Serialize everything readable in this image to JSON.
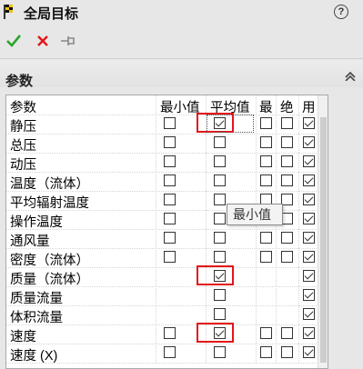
{
  "window": {
    "title": "全局目标",
    "help_glyph": "?"
  },
  "toolbar": {
    "ok_icon": "checkmark-icon",
    "cancel_icon": "close-icon",
    "pin_icon": "pushpin-icon",
    "ok_color": "#2aa52a",
    "cancel_color": "#e3151a"
  },
  "section": {
    "title": "参数"
  },
  "table": {
    "headers": {
      "name": "参数",
      "min": "最小值",
      "avg": "平均值",
      "max": "最",
      "bulk": "绝",
      "use": "用"
    },
    "rows": [
      {
        "name": "静压",
        "min": false,
        "avg": true,
        "max": false,
        "bulk": false,
        "use": true
      },
      {
        "name": "总压",
        "min": false,
        "avg": false,
        "max": false,
        "bulk": false,
        "use": true
      },
      {
        "name": "动压",
        "min": false,
        "avg": false,
        "max": false,
        "bulk": false,
        "use": true
      },
      {
        "name": "温度（流体）",
        "min": false,
        "avg": false,
        "max": false,
        "bulk": false,
        "use": true
      },
      {
        "name": "平均辐射温度",
        "min": false,
        "avg": false,
        "max": false,
        "bulk": false,
        "use": true
      },
      {
        "name": "操作温度",
        "min": false,
        "avg": false,
        "max": false,
        "bulk": false,
        "use": true
      },
      {
        "name": "通风量",
        "min": false,
        "avg": false,
        "max": false,
        "bulk": false,
        "use": true
      },
      {
        "name": "密度（流体）",
        "min": false,
        "avg": false,
        "max": false,
        "bulk": false,
        "use": true
      },
      {
        "name": "质量（流体）",
        "min": null,
        "avg": true,
        "max": null,
        "bulk": null,
        "use": true
      },
      {
        "name": "质量流量",
        "min": null,
        "avg": false,
        "max": null,
        "bulk": null,
        "use": true
      },
      {
        "name": "体积流量",
        "min": null,
        "avg": false,
        "max": null,
        "bulk": null,
        "use": true
      },
      {
        "name": "速度",
        "min": false,
        "avg": true,
        "max": false,
        "bulk": false,
        "use": true
      },
      {
        "name": "速度 (X)",
        "min": false,
        "avg": false,
        "max": false,
        "bulk": false,
        "use": true
      }
    ]
  },
  "tooltip": {
    "text": "最小值"
  },
  "highlight_color": "#e3151a"
}
